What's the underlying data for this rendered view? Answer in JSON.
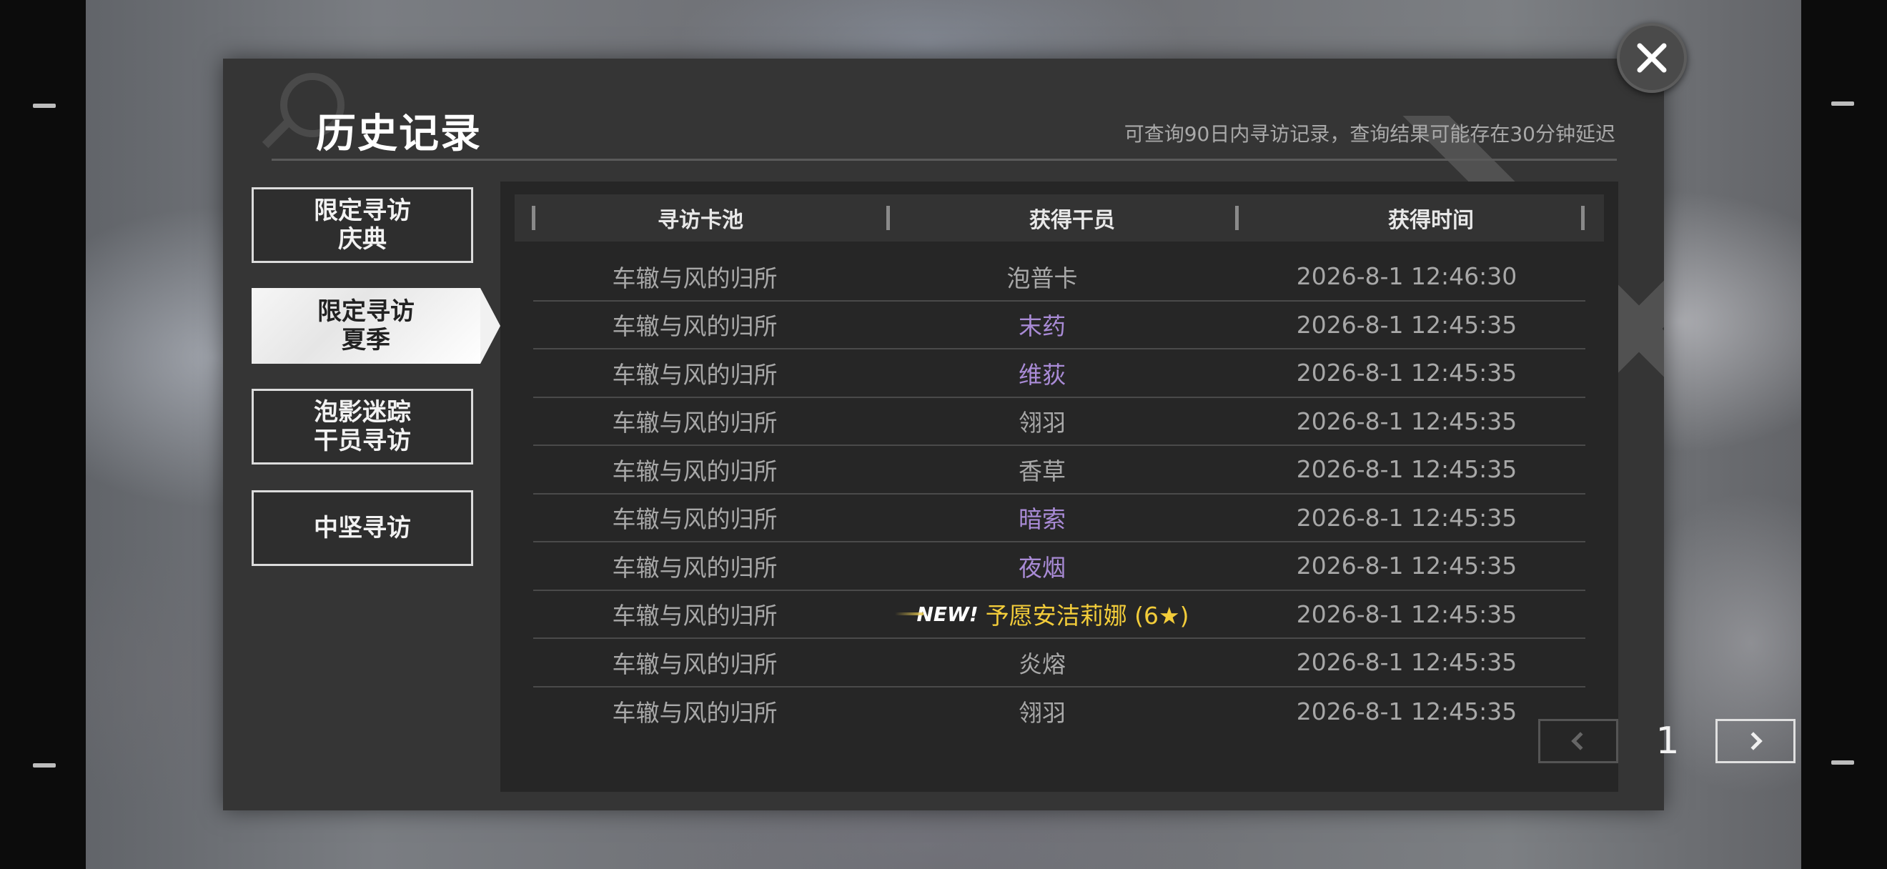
{
  "header": {
    "title": "历史记录",
    "notice": "可查询90日内寻访记录，查询结果可能存在30分钟延迟"
  },
  "tabs": [
    {
      "line1": "限定寻访",
      "line2": "庆典",
      "active": false
    },
    {
      "line1": "限定寻访",
      "line2": "夏季",
      "active": true
    },
    {
      "line1": "泡影迷踪",
      "line2": "干员寻访",
      "active": false
    },
    {
      "line1": "中坚寻访",
      "line2": "",
      "active": false
    }
  ],
  "table": {
    "columns": [
      "寻访卡池",
      "获得干员",
      "获得时间"
    ],
    "rows": [
      {
        "pool": "车辙与风的归所",
        "operator": "泡普卡",
        "time": "2026-8-1 12:46:30",
        "color": "#a8a8a8",
        "is_new": false
      },
      {
        "pool": "车辙与风的归所",
        "operator": "末药",
        "time": "2026-8-1 12:45:35",
        "color": "#a98bd6",
        "is_new": false
      },
      {
        "pool": "车辙与风的归所",
        "operator": "维荻",
        "time": "2026-8-1 12:45:35",
        "color": "#a98bd6",
        "is_new": false
      },
      {
        "pool": "车辙与风的归所",
        "operator": "翎羽",
        "time": "2026-8-1 12:45:35",
        "color": "#a8a8a8",
        "is_new": false
      },
      {
        "pool": "车辙与风的归所",
        "operator": "香草",
        "time": "2026-8-1 12:45:35",
        "color": "#a8a8a8",
        "is_new": false
      },
      {
        "pool": "车辙与风的归所",
        "operator": "暗索",
        "time": "2026-8-1 12:45:35",
        "color": "#a98bd6",
        "is_new": false
      },
      {
        "pool": "车辙与风的归所",
        "operator": "夜烟",
        "time": "2026-8-1 12:45:35",
        "color": "#a98bd6",
        "is_new": false
      },
      {
        "pool": "车辙与风的归所",
        "operator": "予愿安洁莉娜 (6★)",
        "time": "2026-8-1 12:45:35",
        "color": "#f2cc3a",
        "is_new": true,
        "new_label": "NEW!"
      },
      {
        "pool": "车辙与风的归所",
        "operator": "炎熔",
        "time": "2026-8-1 12:45:35",
        "color": "#a8a8a8",
        "is_new": false
      },
      {
        "pool": "车辙与风的归所",
        "operator": "翎羽",
        "time": "2026-8-1 12:45:35",
        "color": "#a8a8a8",
        "is_new": false
      }
    ]
  },
  "pagination": {
    "current_page": "1",
    "prev_icon": "chevron-left-icon",
    "next_icon": "chevron-right-icon"
  },
  "icons": {
    "close": "close-icon",
    "search_decoration": "search-icon"
  }
}
